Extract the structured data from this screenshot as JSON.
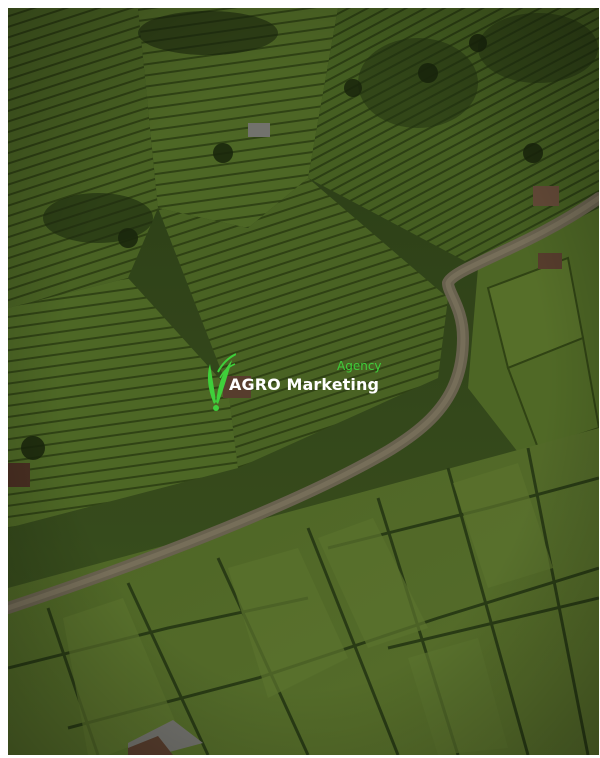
{
  "logo": {
    "tagline": "Agency",
    "name": "AGRO Marketing",
    "icon": "leaf-wheat-logo-icon",
    "accent_color": "#3fcf3b",
    "text_color": "#ffffff"
  },
  "scene": {
    "description_colors": {
      "field_dark": "#3f5a22",
      "field_light": "#6f8c3a",
      "road": "#8a7f66"
    }
  }
}
